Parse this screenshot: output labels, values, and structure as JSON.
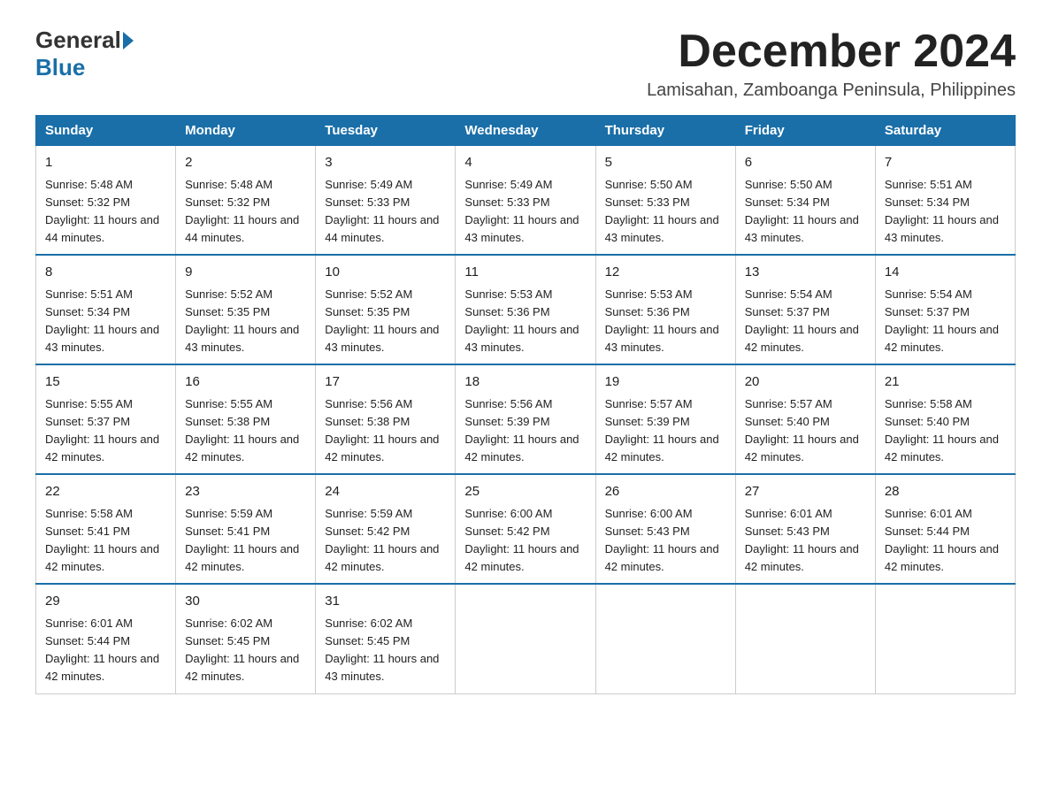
{
  "logo": {
    "general": "General",
    "blue": "Blue"
  },
  "title": {
    "month": "December 2024",
    "location": "Lamisahan, Zamboanga Peninsula, Philippines"
  },
  "headers": [
    "Sunday",
    "Monday",
    "Tuesday",
    "Wednesday",
    "Thursday",
    "Friday",
    "Saturday"
  ],
  "weeks": [
    [
      {
        "day": "1",
        "sunrise": "5:48 AM",
        "sunset": "5:32 PM",
        "daylight": "11 hours and 44 minutes."
      },
      {
        "day": "2",
        "sunrise": "5:48 AM",
        "sunset": "5:32 PM",
        "daylight": "11 hours and 44 minutes."
      },
      {
        "day": "3",
        "sunrise": "5:49 AM",
        "sunset": "5:33 PM",
        "daylight": "11 hours and 44 minutes."
      },
      {
        "day": "4",
        "sunrise": "5:49 AM",
        "sunset": "5:33 PM",
        "daylight": "11 hours and 43 minutes."
      },
      {
        "day": "5",
        "sunrise": "5:50 AM",
        "sunset": "5:33 PM",
        "daylight": "11 hours and 43 minutes."
      },
      {
        "day": "6",
        "sunrise": "5:50 AM",
        "sunset": "5:34 PM",
        "daylight": "11 hours and 43 minutes."
      },
      {
        "day": "7",
        "sunrise": "5:51 AM",
        "sunset": "5:34 PM",
        "daylight": "11 hours and 43 minutes."
      }
    ],
    [
      {
        "day": "8",
        "sunrise": "5:51 AM",
        "sunset": "5:34 PM",
        "daylight": "11 hours and 43 minutes."
      },
      {
        "day": "9",
        "sunrise": "5:52 AM",
        "sunset": "5:35 PM",
        "daylight": "11 hours and 43 minutes."
      },
      {
        "day": "10",
        "sunrise": "5:52 AM",
        "sunset": "5:35 PM",
        "daylight": "11 hours and 43 minutes."
      },
      {
        "day": "11",
        "sunrise": "5:53 AM",
        "sunset": "5:36 PM",
        "daylight": "11 hours and 43 minutes."
      },
      {
        "day": "12",
        "sunrise": "5:53 AM",
        "sunset": "5:36 PM",
        "daylight": "11 hours and 43 minutes."
      },
      {
        "day": "13",
        "sunrise": "5:54 AM",
        "sunset": "5:37 PM",
        "daylight": "11 hours and 42 minutes."
      },
      {
        "day": "14",
        "sunrise": "5:54 AM",
        "sunset": "5:37 PM",
        "daylight": "11 hours and 42 minutes."
      }
    ],
    [
      {
        "day": "15",
        "sunrise": "5:55 AM",
        "sunset": "5:37 PM",
        "daylight": "11 hours and 42 minutes."
      },
      {
        "day": "16",
        "sunrise": "5:55 AM",
        "sunset": "5:38 PM",
        "daylight": "11 hours and 42 minutes."
      },
      {
        "day": "17",
        "sunrise": "5:56 AM",
        "sunset": "5:38 PM",
        "daylight": "11 hours and 42 minutes."
      },
      {
        "day": "18",
        "sunrise": "5:56 AM",
        "sunset": "5:39 PM",
        "daylight": "11 hours and 42 minutes."
      },
      {
        "day": "19",
        "sunrise": "5:57 AM",
        "sunset": "5:39 PM",
        "daylight": "11 hours and 42 minutes."
      },
      {
        "day": "20",
        "sunrise": "5:57 AM",
        "sunset": "5:40 PM",
        "daylight": "11 hours and 42 minutes."
      },
      {
        "day": "21",
        "sunrise": "5:58 AM",
        "sunset": "5:40 PM",
        "daylight": "11 hours and 42 minutes."
      }
    ],
    [
      {
        "day": "22",
        "sunrise": "5:58 AM",
        "sunset": "5:41 PM",
        "daylight": "11 hours and 42 minutes."
      },
      {
        "day": "23",
        "sunrise": "5:59 AM",
        "sunset": "5:41 PM",
        "daylight": "11 hours and 42 minutes."
      },
      {
        "day": "24",
        "sunrise": "5:59 AM",
        "sunset": "5:42 PM",
        "daylight": "11 hours and 42 minutes."
      },
      {
        "day": "25",
        "sunrise": "6:00 AM",
        "sunset": "5:42 PM",
        "daylight": "11 hours and 42 minutes."
      },
      {
        "day": "26",
        "sunrise": "6:00 AM",
        "sunset": "5:43 PM",
        "daylight": "11 hours and 42 minutes."
      },
      {
        "day": "27",
        "sunrise": "6:01 AM",
        "sunset": "5:43 PM",
        "daylight": "11 hours and 42 minutes."
      },
      {
        "day": "28",
        "sunrise": "6:01 AM",
        "sunset": "5:44 PM",
        "daylight": "11 hours and 42 minutes."
      }
    ],
    [
      {
        "day": "29",
        "sunrise": "6:01 AM",
        "sunset": "5:44 PM",
        "daylight": "11 hours and 42 minutes."
      },
      {
        "day": "30",
        "sunrise": "6:02 AM",
        "sunset": "5:45 PM",
        "daylight": "11 hours and 42 minutes."
      },
      {
        "day": "31",
        "sunrise": "6:02 AM",
        "sunset": "5:45 PM",
        "daylight": "11 hours and 43 minutes."
      },
      null,
      null,
      null,
      null
    ]
  ]
}
